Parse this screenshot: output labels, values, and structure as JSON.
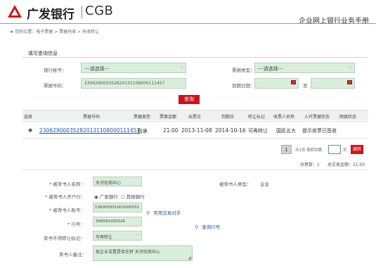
{
  "header": {
    "bank_name": "广发银行",
    "bank_code": "CGB",
    "manual_title": "企业网上银行业务手册"
  },
  "breadcrumb": "★ 您的位置：电子票据 > 票据托收 > 托收转让",
  "query": {
    "section_title": "填写查询信息",
    "account_label": "银行帐号：",
    "account_value": "---请选择---",
    "bill_type_label": "票据类型：",
    "bill_type_value": "---请选择---",
    "bill_no_label": "票据号码：",
    "bill_no_value": "230629000352820131108000111457",
    "due_date_label": "到期日期：",
    "range_sep": "至",
    "query_button": "查询"
  },
  "table": {
    "headers": [
      "选择",
      "票据号码",
      "票据类型",
      "票面金额",
      "出票日",
      "到期日",
      "转让标记",
      "收票人名称",
      "入开票据状态",
      "网银状态"
    ],
    "rows": [
      {
        "radio": "◉",
        "bill_no": "230629000352820131108000111457",
        "type": "商承",
        "amount": "21.00",
        "issue": "2013-11-08",
        "due": "2014-10-16",
        "transfer": "可再转让",
        "payee": "国民五大",
        "status": "提示收票已签收",
        "net_status": ""
      }
    ]
  },
  "pager": {
    "current_page": "1",
    "total_text": "共1页 跳转到第",
    "page_unit": "页",
    "go_button": "跳转"
  },
  "summary": {
    "count_text": "总笔数：1",
    "amount_text": "总交易金额：21.00"
  },
  "form": {
    "endorsee_name_label": "* 被背书人名称：",
    "endorsee_name_value": "天河优商中心",
    "endorsee_type_label": "被背书人类型：",
    "endorsee_type_value": "企业",
    "endorsee_bank_label": "* 被背书人开户行：",
    "bank_option_1": "◉ 广发银行",
    "bank_option_2": "○ 其他银行",
    "endorsee_account_label": "* 被背书人账号：",
    "endorsee_account_value": "136000351001000031",
    "common_partner_link": "常用交易对手",
    "bank_no_label": "* 行号：",
    "bank_no_value": "306581000326",
    "query_bank_link": "查询行号",
    "no_transfer_label": "背书不得转让标记：",
    "no_transfer_value": "可再转让",
    "remark_label": "背书人备注：",
    "remark_value": "现企业设置是否在转 天河优商中心"
  }
}
